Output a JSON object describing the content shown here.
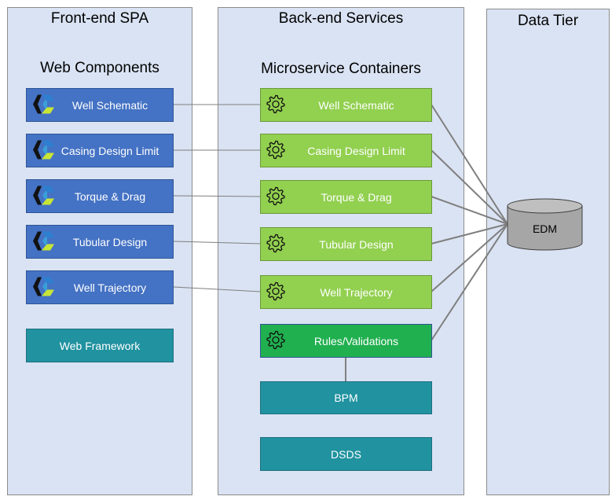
{
  "columns": {
    "frontend": {
      "title": "Front-end SPA",
      "subtitle": "Web Components"
    },
    "backend": {
      "title": "Back-end Services",
      "subtitle": "Microservice Containers"
    },
    "datatier": {
      "title": "Data Tier"
    }
  },
  "web_components": [
    "Well Schematic",
    "Casing Design Limit",
    "Torque & Drag",
    "Tubular Design",
    "Well Trajectory"
  ],
  "web_framework": "Web Framework",
  "microservices": [
    "Well Schematic",
    "Casing Design Limit",
    "Torque & Drag",
    "Tubular Design",
    "Well Trajectory",
    "Rules/Validations"
  ],
  "bpm": "BPM",
  "dsds": "DSDS",
  "database": "EDM",
  "colors": {
    "component": "#4472c4",
    "microservice": "#92d050",
    "rules": "#21b050",
    "infra": "#2092a0",
    "panel": "#dae3f3"
  }
}
